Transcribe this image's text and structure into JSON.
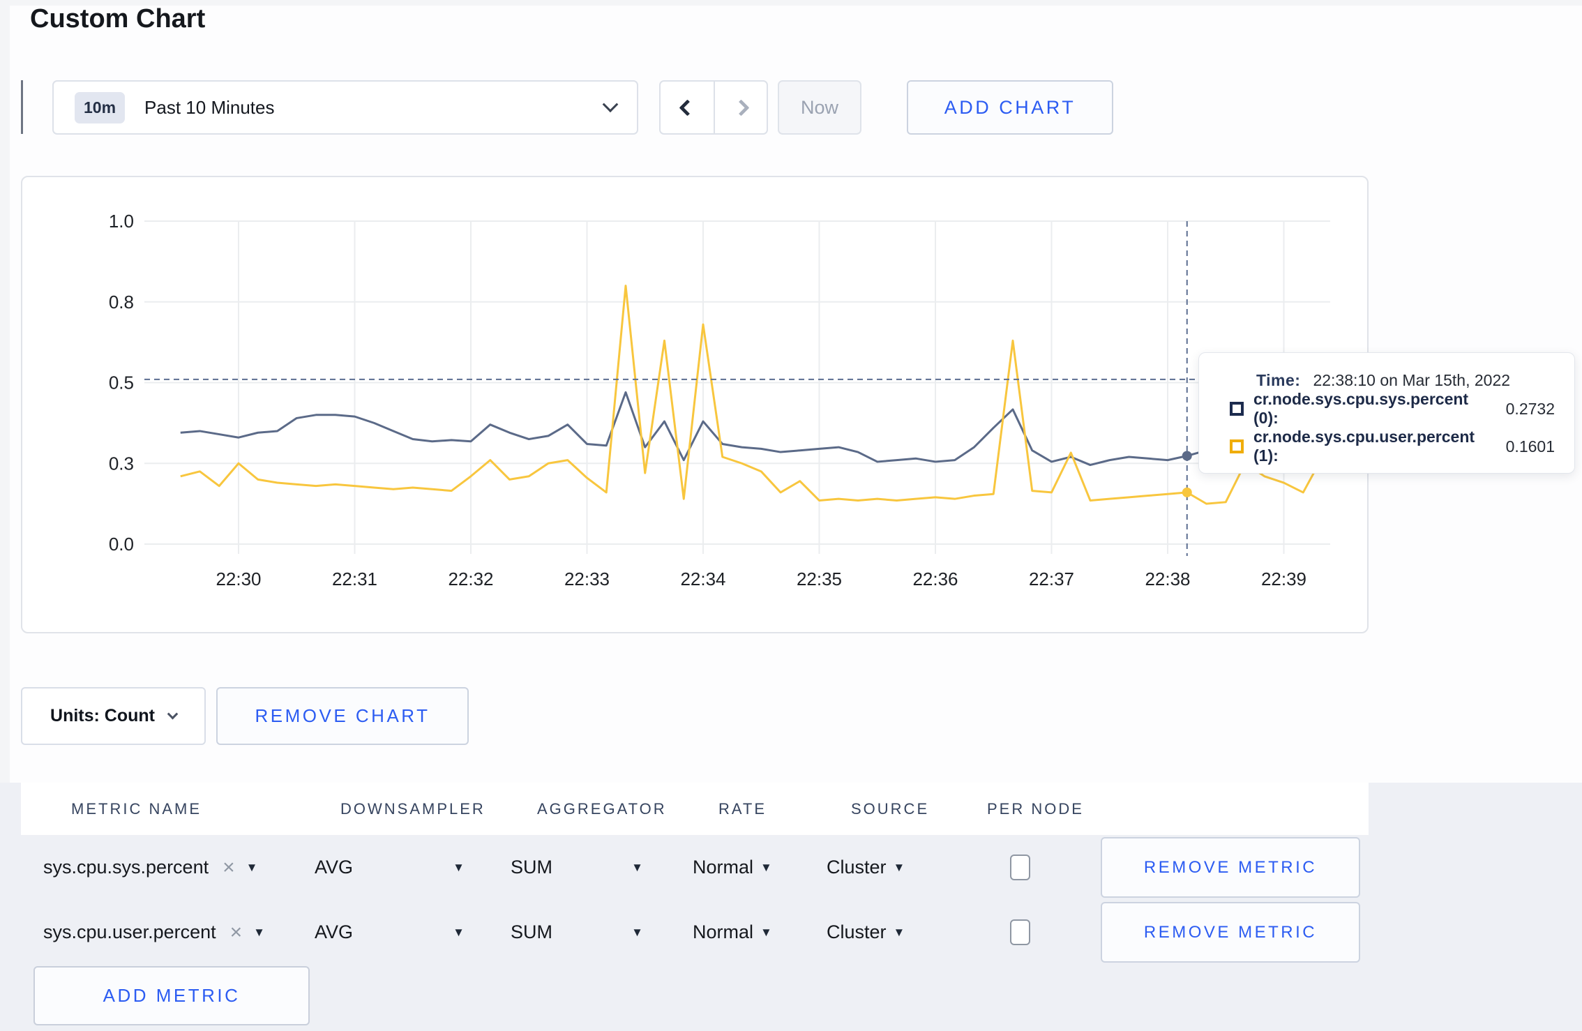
{
  "page": {
    "title": "Custom Chart"
  },
  "toolbar": {
    "time_range": {
      "badge": "10m",
      "label": "Past 10 Minutes"
    },
    "now_label": "Now",
    "add_chart_label": "ADD CHART"
  },
  "chart_data": {
    "type": "line",
    "title": "",
    "xlabel": "",
    "ylabel": "",
    "ylim": [
      0,
      1
    ],
    "grid": true,
    "legend_position": "tooltip",
    "x_start": "22:29:30",
    "x_step_seconds": 10,
    "x_tick_labels": [
      "22:30",
      "22:31",
      "22:32",
      "22:33",
      "22:34",
      "22:35",
      "22:36",
      "22:37",
      "22:38",
      "22:39"
    ],
    "y_tick_values": [
      0,
      0.25,
      0.5,
      0.75,
      1.0
    ],
    "y_tick_labels": [
      "0.0",
      "0.3",
      "0.5",
      "0.8",
      "1.0"
    ],
    "series": [
      {
        "name": "cr.node.sys.cpu.sys.percent (0)",
        "color": "#5b6a88",
        "values": [
          0.345,
          0.35,
          0.34,
          0.33,
          0.345,
          0.35,
          0.39,
          0.4,
          0.4,
          0.395,
          0.375,
          0.35,
          0.325,
          0.318,
          0.322,
          0.318,
          0.37,
          0.345,
          0.325,
          0.335,
          0.37,
          0.31,
          0.305,
          0.47,
          0.3,
          0.38,
          0.26,
          0.38,
          0.31,
          0.3,
          0.295,
          0.285,
          0.29,
          0.295,
          0.3,
          0.285,
          0.255,
          0.26,
          0.265,
          0.255,
          0.26,
          0.3,
          0.36,
          0.417,
          0.29,
          0.255,
          0.27,
          0.245,
          0.26,
          0.27,
          0.265,
          0.26,
          0.2732,
          0.29,
          0.3,
          0.295,
          0.3,
          0.295,
          0.3,
          0.3
        ]
      },
      {
        "name": "cr.node.sys.cpu.user.percent (1)",
        "color": "#f8c63e",
        "values": [
          0.21,
          0.225,
          0.18,
          0.25,
          0.2,
          0.19,
          0.185,
          0.18,
          0.185,
          0.18,
          0.175,
          0.17,
          0.175,
          0.17,
          0.165,
          0.21,
          0.26,
          0.2,
          0.21,
          0.25,
          0.26,
          0.205,
          0.16,
          0.8,
          0.22,
          0.63,
          0.14,
          0.68,
          0.27,
          0.25,
          0.225,
          0.16,
          0.195,
          0.135,
          0.14,
          0.135,
          0.14,
          0.135,
          0.14,
          0.145,
          0.14,
          0.15,
          0.155,
          0.63,
          0.165,
          0.16,
          0.283,
          0.135,
          0.14,
          0.145,
          0.15,
          0.155,
          0.1601,
          0.125,
          0.13,
          0.25,
          0.21,
          0.19,
          0.16,
          0.27
        ]
      }
    ],
    "crosshair": {
      "time_index": 52,
      "time": "22:38:10",
      "y_value": 0.51
    }
  },
  "tooltip": {
    "time_label": "Time:",
    "time_value": "22:38:10 on Mar 15th, 2022",
    "rows": [
      {
        "label": "cr.node.sys.cpu.sys.percent (0):",
        "value": "0.2732",
        "swatch_color": "#1c2b4e"
      },
      {
        "label": "cr.node.sys.cpu.user.percent (1):",
        "value": "0.1601",
        "swatch_color": "#f0ad0b"
      }
    ]
  },
  "chart_controls": {
    "units_label": "Units: Count",
    "remove_chart_label": "REMOVE CHART"
  },
  "metrics_table": {
    "headers": [
      "METRIC NAME",
      "DOWNSAMPLER",
      "AGGREGATOR",
      "RATE",
      "SOURCE",
      "PER NODE"
    ],
    "rows": [
      {
        "metric": "sys.cpu.sys.percent",
        "downsampler": "AVG",
        "aggregator": "SUM",
        "rate": "Normal",
        "source": "Cluster",
        "per_node_checked": false,
        "remove_label": "REMOVE METRIC"
      },
      {
        "metric": "sys.cpu.user.percent",
        "downsampler": "AVG",
        "aggregator": "SUM",
        "rate": "Normal",
        "source": "Cluster",
        "per_node_checked": false,
        "remove_label": "REMOVE METRIC"
      }
    ],
    "add_metric_label": "ADD METRIC"
  },
  "colors": {
    "accent_blue": "#2c5cf2",
    "series_sys": "#5b6a88",
    "series_user": "#f8c63e",
    "crosshair": "#5c6e91",
    "section_bg": "#eef0f5"
  }
}
